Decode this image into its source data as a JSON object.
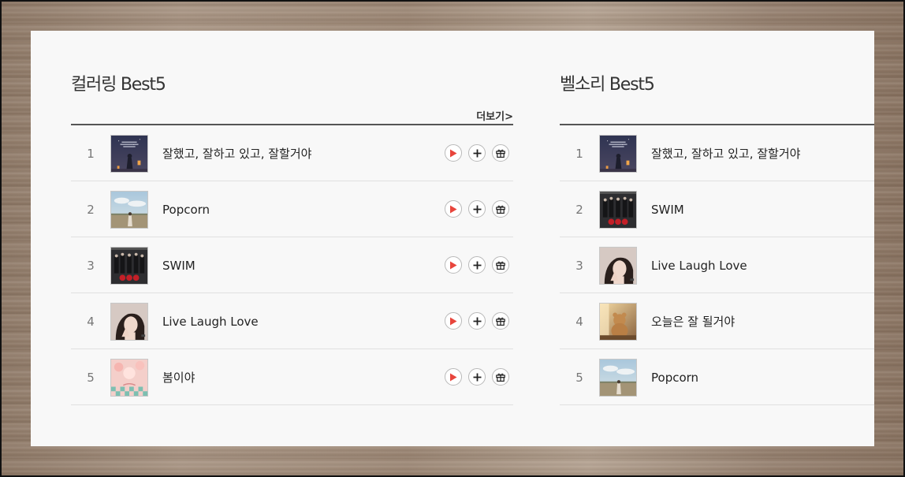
{
  "coloring": {
    "title": "컬러링 Best5",
    "more_label": "더보기>",
    "items": [
      {
        "rank": "1",
        "title": "잘했고, 잘하고 있고, 잘할거야",
        "art": "night-lanterns-art"
      },
      {
        "rank": "2",
        "title": "Popcorn",
        "art": "sky-field-art"
      },
      {
        "rank": "3",
        "title": "SWIM",
        "art": "group-roses-art"
      },
      {
        "rank": "4",
        "title": "Live Laugh Love",
        "art": "portrait-art"
      },
      {
        "rank": "5",
        "title": "봄이야",
        "art": "pink-flowers-art"
      }
    ]
  },
  "bellsound": {
    "title": "벨소리 Best5",
    "items": [
      {
        "rank": "1",
        "title": "잘했고, 잘하고 있고, 잘할거야",
        "art": "night-lanterns-art"
      },
      {
        "rank": "2",
        "title": "SWIM",
        "art": "group-roses-art"
      },
      {
        "rank": "3",
        "title": "Live Laugh Love",
        "art": "portrait-art"
      },
      {
        "rank": "4",
        "title": "오늘은 잘 될거야",
        "art": "teddy-bear-art"
      },
      {
        "rank": "5",
        "title": "Popcorn",
        "art": "sky-field-art"
      }
    ]
  },
  "icons": {
    "play": "play-icon",
    "add": "plus-icon",
    "gift": "gift-icon"
  },
  "colors": {
    "play_accent": "#e8453c",
    "panel_bg": "#f8f8f8",
    "divider_dark": "#555555"
  }
}
